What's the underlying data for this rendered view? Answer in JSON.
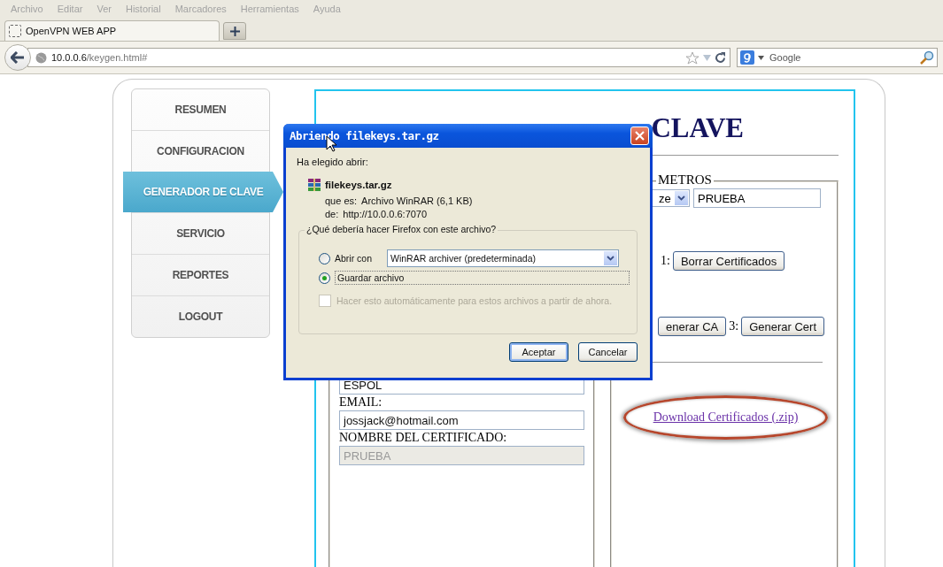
{
  "menu_bar": [
    "Archivo",
    "Editar",
    "Ver",
    "Historial",
    "Marcadores",
    "Herramientas",
    "Ayuda"
  ],
  "tabs": [
    {
      "label": "OpenVPN WEB APP",
      "selected": true
    }
  ],
  "address_bar": {
    "host": "10.0.0.6",
    "path": "/keygen.html#"
  },
  "search": {
    "placeholder": "Google"
  },
  "sidebar": {
    "items": [
      {
        "label": "RESUMEN",
        "selected": false
      },
      {
        "label": "CONFIGURACION",
        "selected": false
      },
      {
        "label": "GENERADOR DE CLAVE",
        "selected": true
      },
      {
        "label": "SERVICIO",
        "selected": false
      },
      {
        "label": "REPORTES",
        "selected": false
      },
      {
        "label": "LOGOUT",
        "selected": false
      }
    ]
  },
  "page": {
    "title": "CLAVE",
    "left_fields": [
      {
        "value": "ESPOL",
        "disabled": false
      },
      {
        "label": "EMAIL:",
        "value": "jossjack@hotmail.com",
        "disabled": false
      },
      {
        "label": "NOMBRE DEL CERTIFICADO:",
        "value": "PRUEBA",
        "disabled": true
      }
    ],
    "right": {
      "legend": "METROS",
      "select_value": "ze",
      "name_value": "PRUEBA",
      "steps": [
        {
          "number": "1:",
          "button": "Borrar Certificados"
        }
      ],
      "steps2": [
        {
          "button": "enerar CA"
        },
        {
          "number": "3:",
          "button": "Generar Cert"
        }
      ],
      "link": {
        "label": "Download Certificados (.zip)",
        "circled": true
      }
    }
  },
  "dialog": {
    "title": "Abriendo filekeys.tar.gz",
    "intro": "Ha elegido abrir:",
    "file_name": "filekeys.tar.gz",
    "type_label": "que es:",
    "type_value": "Archivo WinRAR (6,1 KB)",
    "from_label": "de:",
    "from_value": "http://10.0.0.6:7070",
    "group_legend": "¿Qué debería hacer Firefox con este archivo?",
    "options": [
      {
        "kind": "app",
        "label": "Abrir con",
        "app": "WinRAR archiver (predeterminada)",
        "selected": false
      },
      {
        "kind": "plain",
        "label": "Guardar archivo",
        "selected": true
      }
    ],
    "remember": {
      "label": "Hacer esto automáticamente para estos archivos a partir de ahora.",
      "checked": false,
      "disabled": true
    },
    "buttons": [
      {
        "label": "Aceptar",
        "default": true
      },
      {
        "label": "Cancelar",
        "default": false
      }
    ]
  }
}
